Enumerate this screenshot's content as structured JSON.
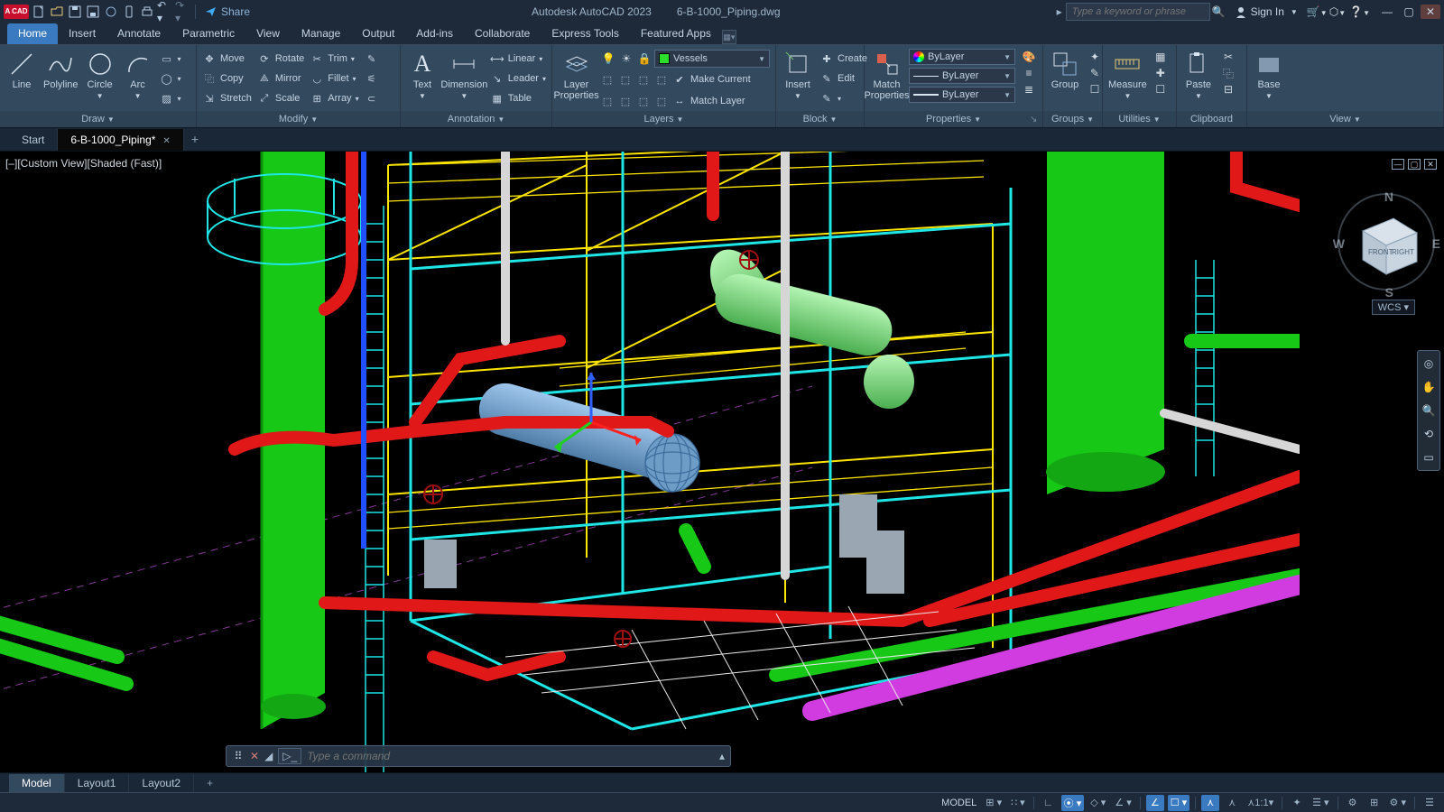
{
  "app": {
    "badge": "A CAD",
    "title_left": "Autodesk AutoCAD 2023",
    "title_right": "6-B-1000_Piping.dwg",
    "share": "Share",
    "search_placeholder": "Type a keyword or phrase",
    "signin": "Sign In"
  },
  "menus": [
    "Home",
    "Insert",
    "Annotate",
    "Parametric",
    "View",
    "Manage",
    "Output",
    "Add-ins",
    "Collaborate",
    "Express Tools",
    "Featured Apps"
  ],
  "active_menu": "Home",
  "ribbon": {
    "draw": {
      "label": "Draw",
      "items": [
        "Line",
        "Polyline",
        "Circle",
        "Arc"
      ]
    },
    "modify": {
      "label": "Modify",
      "rows": [
        [
          "Move",
          "Rotate",
          "Trim"
        ],
        [
          "Copy",
          "Mirror",
          "Fillet"
        ],
        [
          "Stretch",
          "Scale",
          "Array"
        ]
      ]
    },
    "annotation": {
      "label": "Annotation",
      "big": [
        "Text",
        "Dimension"
      ],
      "rows": [
        "Linear",
        "Leader",
        "Table"
      ]
    },
    "layers": {
      "label": "Layers",
      "big": "Layer\nProperties",
      "combo": "Vessels",
      "rows": [
        "Make Current",
        "Match Layer"
      ]
    },
    "block": {
      "label": "Block",
      "big": "Insert",
      "rows": [
        "Create",
        "Edit"
      ]
    },
    "properties": {
      "label": "Properties",
      "big": "Match\nProperties",
      "col": "ByLayer",
      "lt": "ByLayer",
      "lw": "ByLayer"
    },
    "groups": {
      "label": "Groups",
      "big": "Group"
    },
    "utilities": {
      "label": "Utilities",
      "big": "Measure"
    },
    "clipboard": {
      "label": "Clipboard",
      "big": "Paste"
    },
    "view": {
      "label": "View",
      "big": "Base"
    }
  },
  "filetabs": {
    "start": "Start",
    "active": "6-B-1000_Piping*"
  },
  "viewport": {
    "label": "[–][Custom View][Shaded (Fast)]",
    "wcs": "WCS",
    "cube_front": "FRONT",
    "cube_right": "RIGHT"
  },
  "cmd": {
    "placeholder": "Type a command"
  },
  "layouts": [
    "Model",
    "Layout1",
    "Layout2"
  ],
  "status": {
    "model": "MODEL",
    "scale": "1:1"
  }
}
